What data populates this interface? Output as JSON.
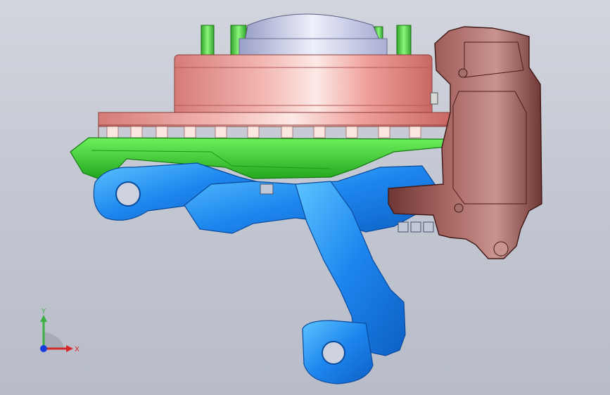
{
  "viewport": {
    "background_top": "#d2d5de",
    "background_bottom": "#b7bcc8"
  },
  "model": {
    "parts": [
      "wheel-hub",
      "brake-disc",
      "wheel-studs",
      "brake-caliper",
      "dust-shield",
      "steering-knuckle",
      "tie-rod-arm"
    ],
    "colors": {
      "hub": "#e0a8a8",
      "disc": "#eb9c96",
      "studs": "#47d43a",
      "shield": "#3fd63a",
      "caliper": "#9a5a58",
      "knuckle": "#2b8ff0",
      "knuckle_light": "#5cb8ff"
    }
  },
  "triad": {
    "y_label": "Y",
    "x_label": "X",
    "y_color": "#3cb043",
    "x_color": "#d62828",
    "z_color": "#1a3adb"
  }
}
